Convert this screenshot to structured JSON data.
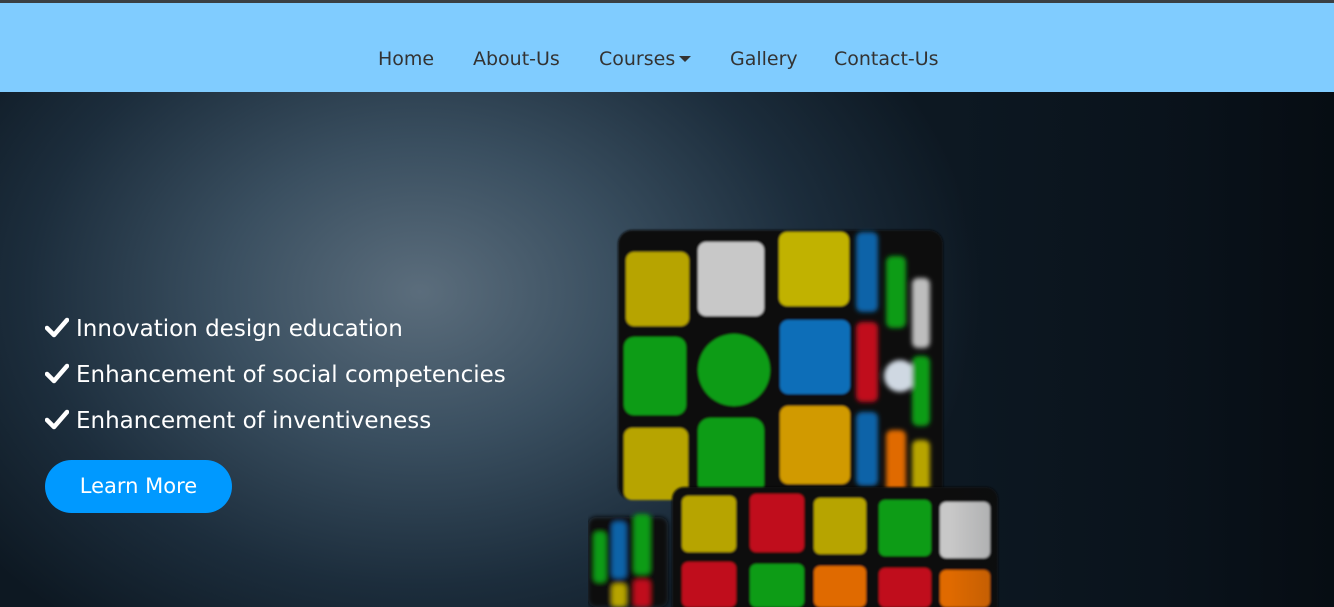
{
  "nav": {
    "items": [
      {
        "label": "Home"
      },
      {
        "label": "About-Us"
      },
      {
        "label": "Courses"
      },
      {
        "label": "Gallery"
      },
      {
        "label": "Contact-Us"
      }
    ]
  },
  "hero": {
    "features": [
      {
        "label": "Innovation design education",
        "icon": "check-icon"
      },
      {
        "label": "Enhancement of social competencies",
        "icon": "check-icon"
      },
      {
        "label": "Enhancement of inventiveness",
        "icon": "check-icon"
      }
    ],
    "cta_label": "Learn More"
  },
  "colors": {
    "navbar_bg": "#80ccff",
    "nav_text": "#333333",
    "cta_bg": "#0099ff",
    "cta_text": "#ffffff",
    "hero_text": "#ffffff"
  }
}
